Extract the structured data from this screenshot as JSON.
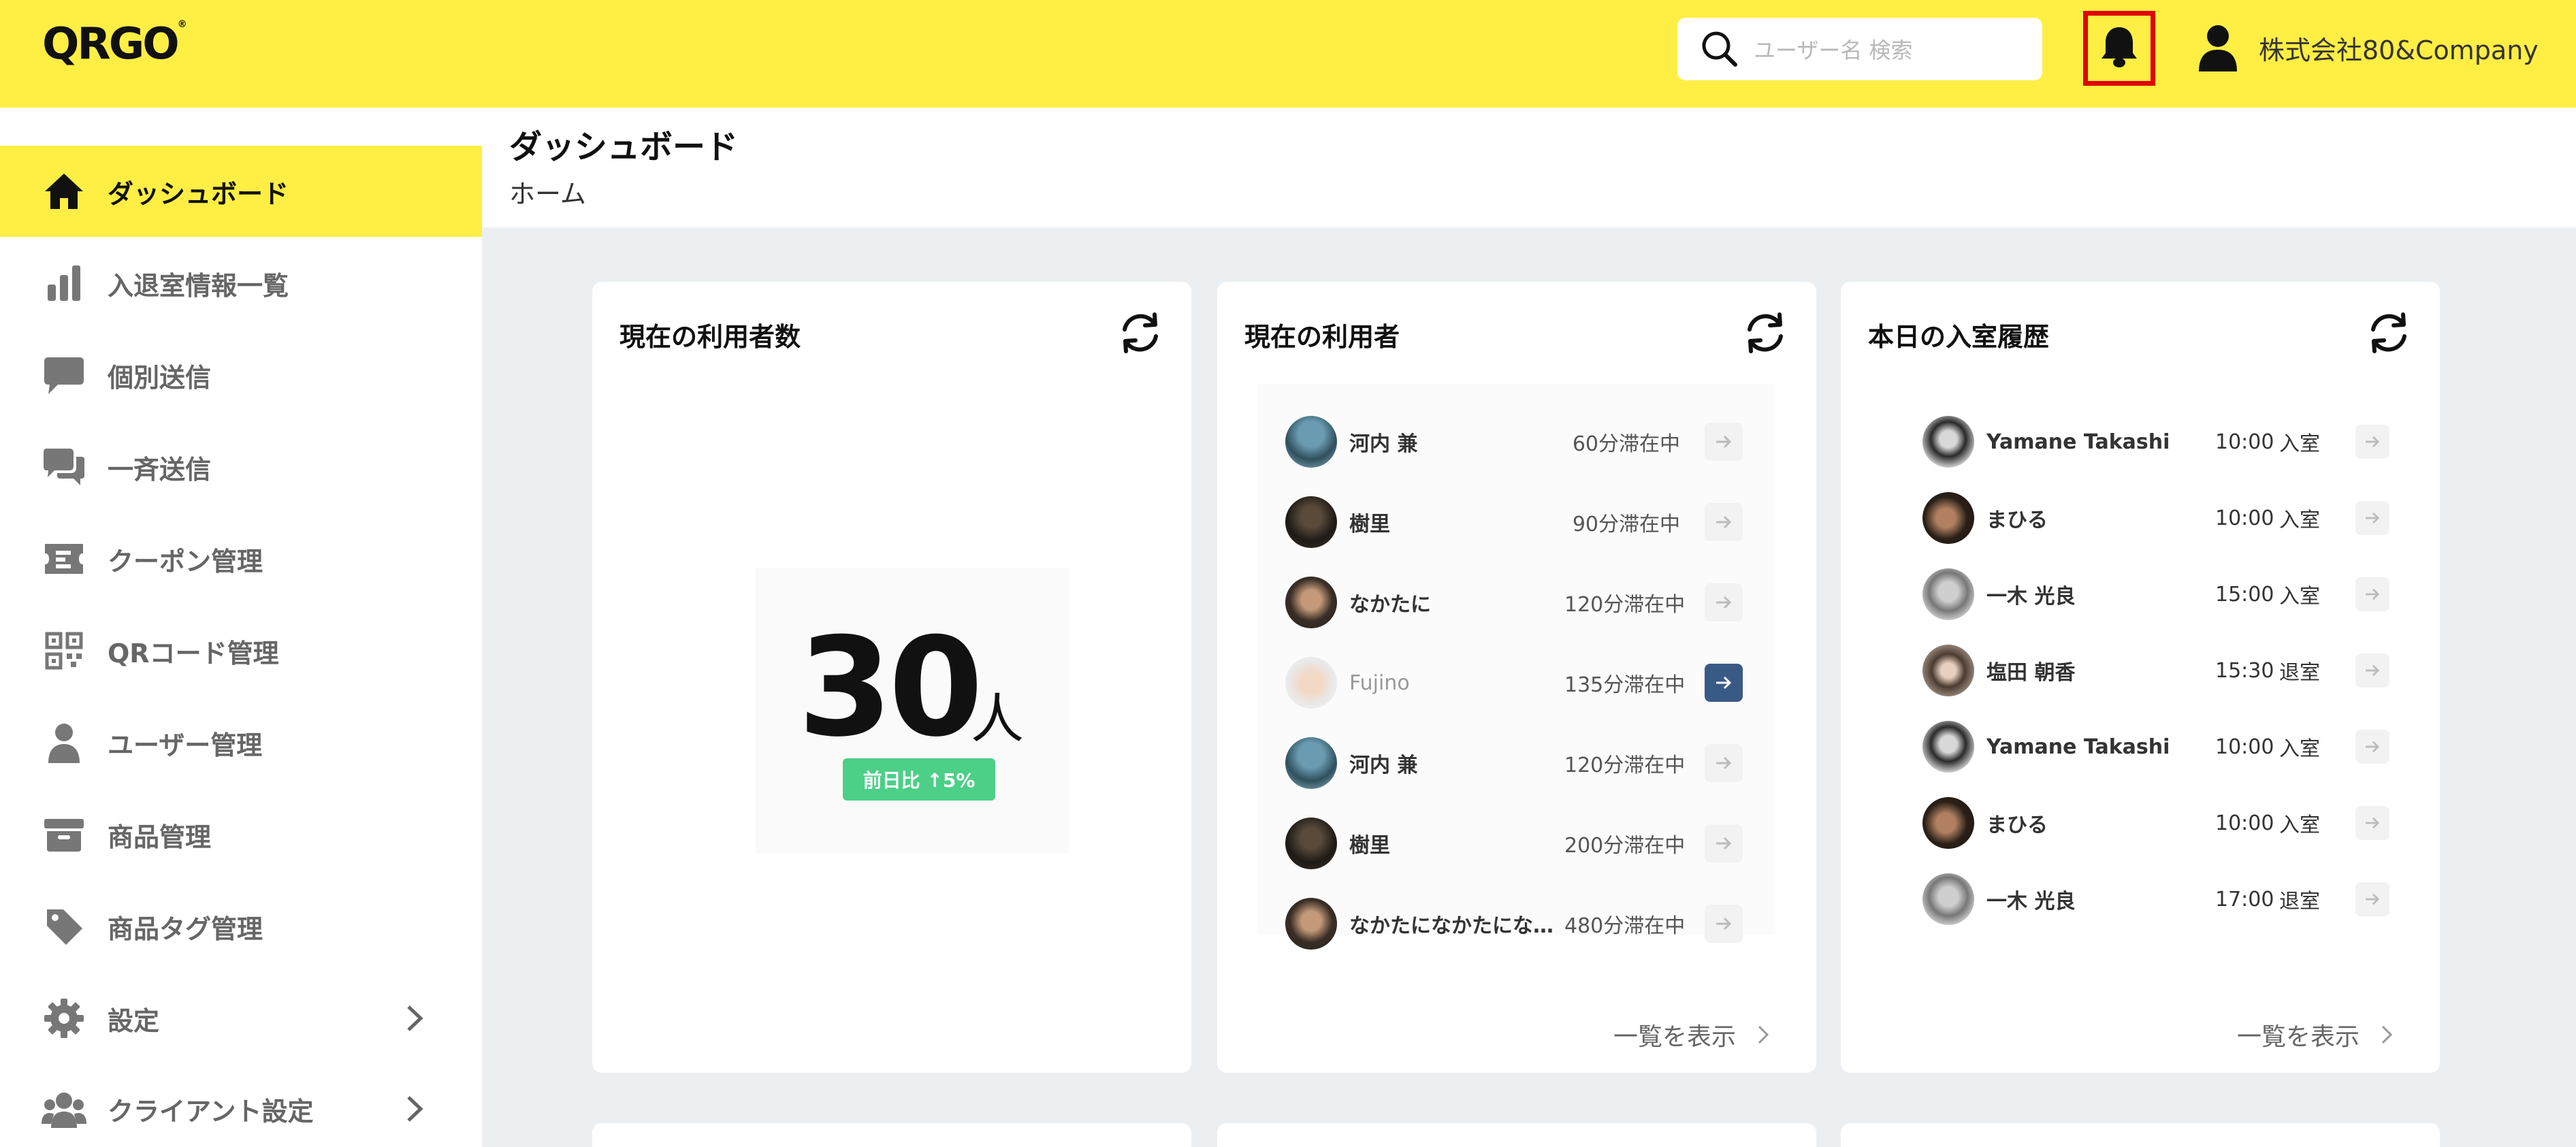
{
  "header": {
    "logo": "QRGO",
    "search_placeholder": "ユーザー名 検索",
    "company_name": "株式会社80&Company"
  },
  "sidebar": {
    "items": [
      {
        "label": "ダッシュボード"
      },
      {
        "label": "入退室情報一覧"
      },
      {
        "label": "個別送信"
      },
      {
        "label": "一斉送信"
      },
      {
        "label": "クーポン管理"
      },
      {
        "label": "QRコード管理"
      },
      {
        "label": "ユーザー管理"
      },
      {
        "label": "商品管理"
      },
      {
        "label": "商品タグ管理"
      },
      {
        "label": "設定"
      },
      {
        "label": "クライアント設定"
      }
    ]
  },
  "page": {
    "title": "ダッシュボード",
    "breadcrumb": "ホーム"
  },
  "cards": {
    "count": {
      "title": "現在の利用者数",
      "number": "30",
      "unit": "人",
      "badge": "前日比 ↑5%"
    },
    "current_users": {
      "title": "現在の利用者",
      "rows": [
        {
          "name": "河内 兼",
          "stay": "60分滞在中"
        },
        {
          "name": "樹里",
          "stay": "90分滞在中"
        },
        {
          "name": "なかたに",
          "stay": "120分滞在中"
        },
        {
          "name": "Fujino",
          "stay": "135分滞在中"
        },
        {
          "name": "河内 兼",
          "stay": "120分滞在中"
        },
        {
          "name": "樹里",
          "stay": "200分滞在中"
        },
        {
          "name": "なかたになかたにな...",
          "stay": "480分滞在中"
        }
      ],
      "show_all": "一覧を表示"
    },
    "history": {
      "title": "本日の入室履歴",
      "rows": [
        {
          "name": "Yamane Takashi",
          "time": "10:00",
          "kind": "入室"
        },
        {
          "name": "まひる",
          "time": "10:00",
          "kind": "入室"
        },
        {
          "name": "一木 光良",
          "time": "15:00",
          "kind": "入室"
        },
        {
          "name": "塩田 朝香",
          "time": "15:30",
          "kind": "退室"
        },
        {
          "name": "Yamane Takashi",
          "time": "10:00",
          "kind": "入室"
        },
        {
          "name": "まひる",
          "time": "10:00",
          "kind": "入室"
        },
        {
          "name": "一木 光良",
          "time": "17:00",
          "kind": "退室"
        }
      ],
      "show_all": "一覧を表示"
    }
  },
  "colors": {
    "brand_yellow": "#ffee44",
    "badge_green": "#4ccf87",
    "highlight_red": "#e00000",
    "active_arrow": "#3a5a86"
  }
}
